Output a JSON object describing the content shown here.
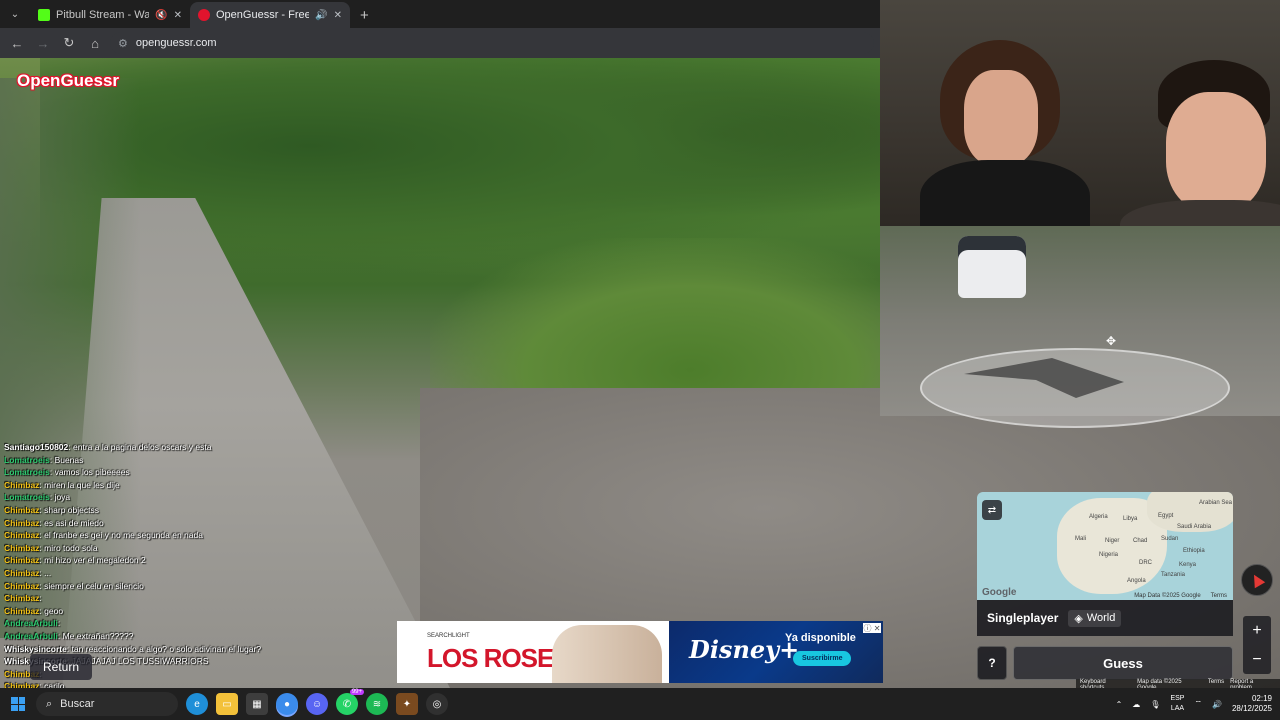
{
  "browser": {
    "tabs": [
      {
        "title": "Pitbull Stream - Watch Live",
        "favicon_color": "#53fc18",
        "active": false
      },
      {
        "title": "OpenGuessr - Free GeoGuessr",
        "favicon_color": "#e2142d",
        "active": true
      }
    ],
    "new_tab_icon": "+",
    "url": "openguessr.com"
  },
  "app": {
    "logo": "OpenGuessr"
  },
  "chat": [
    {
      "user": "Santiago150802",
      "color": "#ffffff",
      "message": "entra a la pagina delos oscars y esta"
    },
    {
      "user": "Lomatroeis",
      "color": "#2ecc71",
      "message": "Buenas"
    },
    {
      "user": "Lomatroeis",
      "color": "#2ecc71",
      "message": "vamos los pibeeees"
    },
    {
      "user": "Chimbaz",
      "color": "#f5c518",
      "message": "miren la que les dije"
    },
    {
      "user": "Lomatroeis",
      "color": "#2ecc71",
      "message": "joya"
    },
    {
      "user": "Chimbaz",
      "color": "#f5c518",
      "message": "sharp objectss"
    },
    {
      "user": "Chimbaz",
      "color": "#f5c518",
      "message": "es asi de miedo"
    },
    {
      "user": "Chimbaz",
      "color": "#f5c518",
      "message": "el franbe es gei y no me segunda en nada"
    },
    {
      "user": "Chimbaz",
      "color": "#f5c518",
      "message": "miro todo sola"
    },
    {
      "user": "Chimbaz",
      "color": "#f5c518",
      "message": "mi hizo ver el megaledon 2"
    },
    {
      "user": "Chimbaz",
      "color": "#f5c518",
      "message": "..."
    },
    {
      "user": "Chimbaz",
      "color": "#f5c518",
      "message": "siempre el celu en silencio"
    },
    {
      "user": "Chimbaz",
      "color": "#f5c518",
      "message": ""
    },
    {
      "user": "Chimbaz",
      "color": "#f5c518",
      "message": "geoo"
    },
    {
      "user": "AndreaArbuli",
      "color": "#2ecc71",
      "message": ""
    },
    {
      "user": "AndreaArbuli",
      "color": "#2ecc71",
      "message": "Me extrañan?????"
    },
    {
      "user": "Whiskysincorte",
      "color": "#ffffff",
      "message": "tan reaccionando a algo? o solo adivinan el lugar?"
    },
    {
      "user": "Whiskysincorte",
      "color": "#ffffff",
      "message": "JAJAJAJAJ LOS TUSSIWARRIORS"
    },
    {
      "user": "Chimbaz",
      "color": "#f5c518",
      "message": ""
    },
    {
      "user": "Chimbaz",
      "color": "#f5c518",
      "message": "carilo"
    }
  ],
  "return_label": "Return",
  "ad": {
    "studio": "SEARCHLIGHT",
    "title": "LOS ROSES",
    "brand": "Disney+",
    "available": "Ya disponible",
    "cta": "Suscribirme"
  },
  "map": {
    "labels": [
      "Algeria",
      "Libya",
      "Egypt",
      "Saudi Arabia",
      "Mali",
      "Niger",
      "Chad",
      "Sudan",
      "Ethiopia",
      "Nigeria",
      "DRC",
      "Tanzania",
      "Angola",
      "Kenya",
      "Arabian Sea"
    ],
    "copyright": "Map Data ©2025 Google",
    "terms": "Terms",
    "google": "Google"
  },
  "mode": {
    "type": "Singleplayer",
    "region": "World"
  },
  "help_label": "?",
  "guess_label": "Guess",
  "zoom": {
    "plus": "+",
    "minus": "−"
  },
  "sv_footer": {
    "shortcuts": "Keyboard shortcuts",
    "data": "Map data ©2025 Google",
    "terms": "Terms",
    "report": "Report a problem"
  },
  "taskbar": {
    "search": "Buscar",
    "badge": "99+",
    "lang": "ESP",
    "lang2": "LAA",
    "time": "02:19",
    "date": "28/12/2025"
  }
}
